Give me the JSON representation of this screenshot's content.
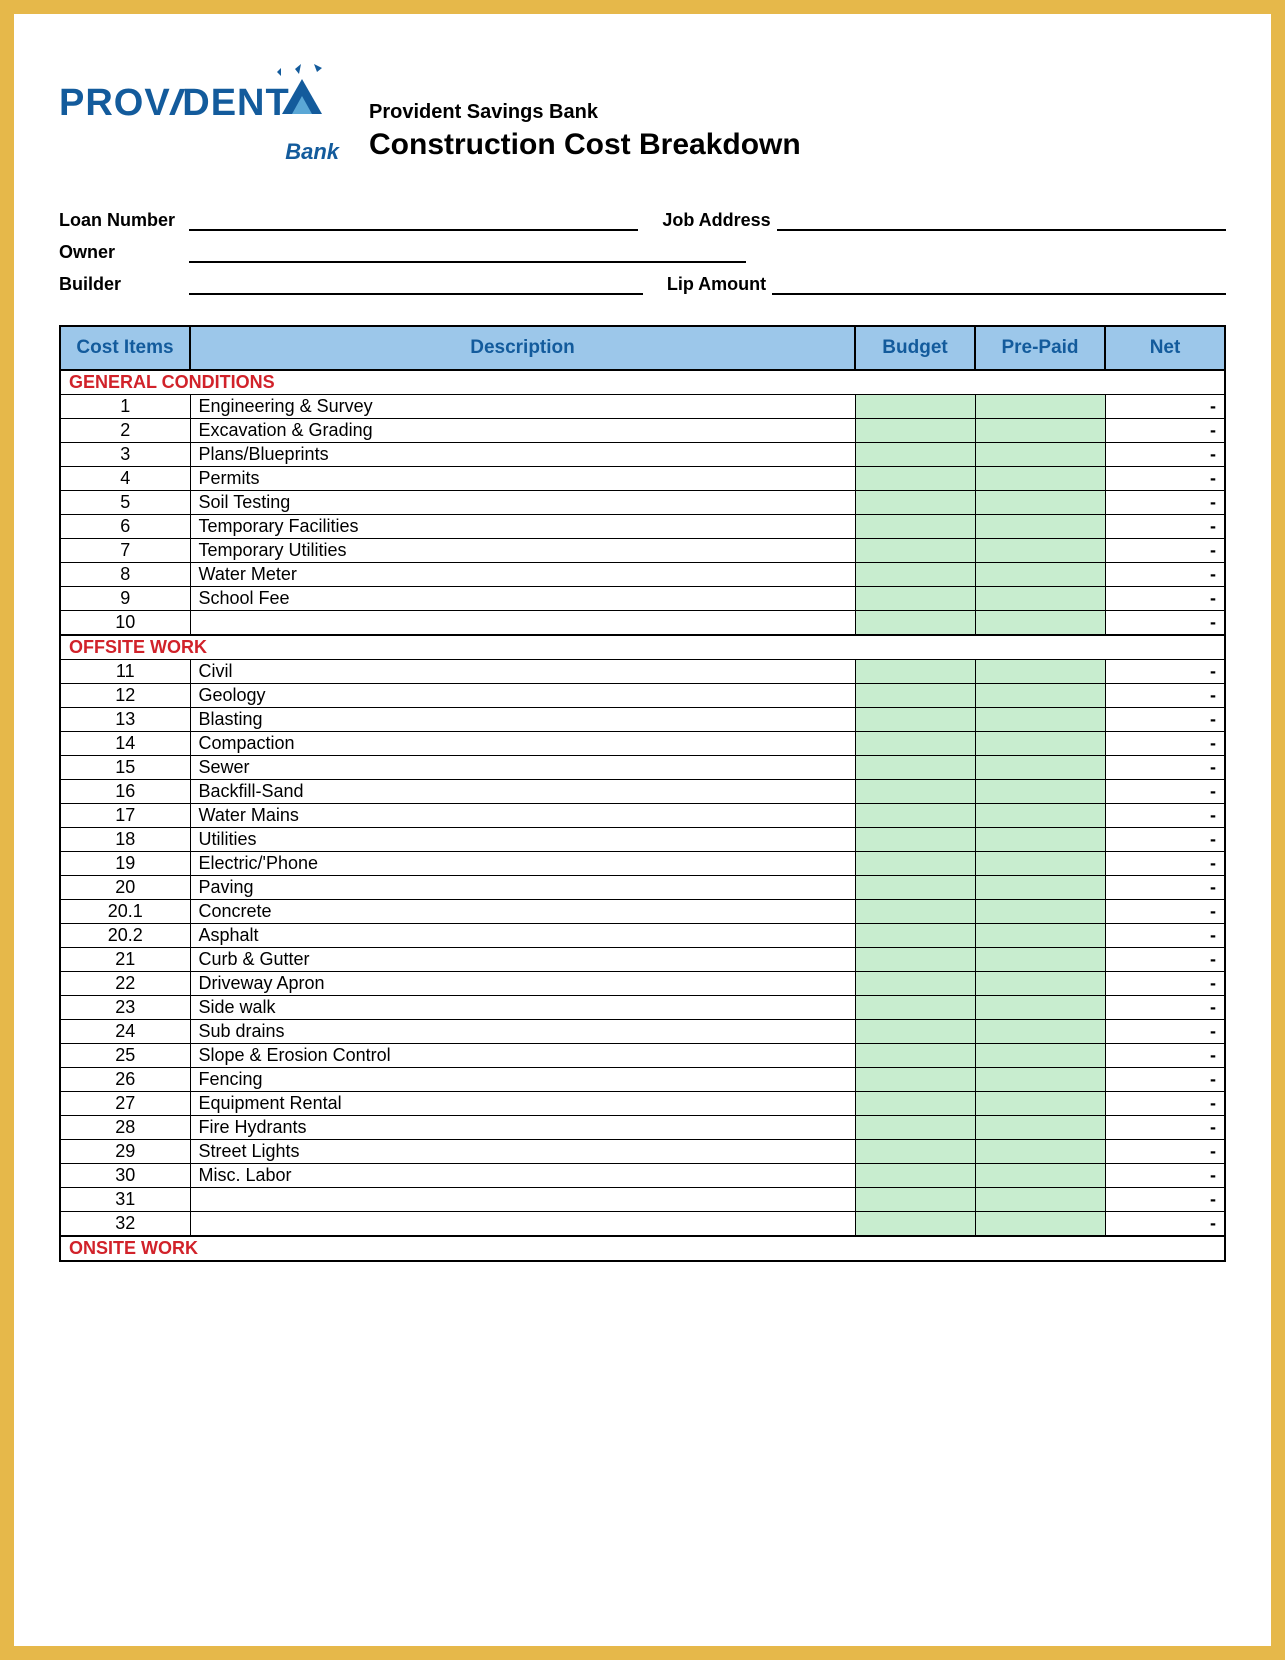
{
  "header": {
    "logo_text": "PROV",
    "logo_text2": "DENT",
    "logo_bank": "Bank",
    "subtitle": "Provident Savings Bank",
    "title": "Construction Cost Breakdown"
  },
  "form": {
    "loan_number_label": "Loan Number",
    "job_address_label": "Job Address",
    "owner_label": "Owner",
    "builder_label": "Builder",
    "lip_amount_label": "Lip Amount"
  },
  "columns": {
    "cost_items": "Cost  Items",
    "description": "Description",
    "budget": "Budget",
    "prepaid": "Pre-Paid",
    "net": "Net"
  },
  "sections": [
    {
      "title": "GENERAL CONDITIONS",
      "rows": [
        {
          "num": "1",
          "desc": "Engineering & Survey",
          "net": "-"
        },
        {
          "num": "2",
          "desc": "Excavation & Grading",
          "net": "-"
        },
        {
          "num": "3",
          "desc": "Plans/Blueprints",
          "net": "-"
        },
        {
          "num": "4",
          "desc": "Permits",
          "net": "-"
        },
        {
          "num": "5",
          "desc": "Soil Testing",
          "net": "-"
        },
        {
          "num": "6",
          "desc": "Temporary Facilities",
          "net": "-"
        },
        {
          "num": "7",
          "desc": "Temporary Utilities",
          "net": "-"
        },
        {
          "num": "8",
          "desc": "Water Meter",
          "net": "-"
        },
        {
          "num": "9",
          "desc": "School Fee",
          "net": "-"
        },
        {
          "num": "10",
          "desc": "",
          "net": "-"
        }
      ]
    },
    {
      "title": "OFFSITE WORK",
      "rows": [
        {
          "num": "11",
          "desc": "Civil",
          "net": "-"
        },
        {
          "num": "12",
          "desc": "Geology",
          "net": "-"
        },
        {
          "num": "13",
          "desc": "Blasting",
          "net": "-"
        },
        {
          "num": "14",
          "desc": "Compaction",
          "net": "-"
        },
        {
          "num": "15",
          "desc": "Sewer",
          "net": "-"
        },
        {
          "num": "16",
          "desc": "Backfill-Sand",
          "net": "-"
        },
        {
          "num": "17",
          "desc": "Water Mains",
          "net": "-"
        },
        {
          "num": "18",
          "desc": "Utilities",
          "net": "-"
        },
        {
          "num": "19",
          "desc": "Electric/'Phone",
          "net": "-"
        },
        {
          "num": "20",
          "desc": "Paving",
          "net": "-"
        },
        {
          "num": "20.1",
          "desc": "Concrete",
          "net": "-"
        },
        {
          "num": "20.2",
          "desc": "Asphalt",
          "net": "-"
        },
        {
          "num": "21",
          "desc": "Curb & Gutter",
          "net": "-"
        },
        {
          "num": "22",
          "desc": "Driveway Apron",
          "net": "-"
        },
        {
          "num": "23",
          "desc": "Side walk",
          "net": "-"
        },
        {
          "num": "24",
          "desc": "Sub drains",
          "net": "-"
        },
        {
          "num": "25",
          "desc": "Slope & Erosion Control",
          "net": "-"
        },
        {
          "num": "26",
          "desc": "Fencing",
          "net": "-"
        },
        {
          "num": "27",
          "desc": "Equipment Rental",
          "net": "-"
        },
        {
          "num": "28",
          "desc": "Fire Hydrants",
          "net": "-"
        },
        {
          "num": "29",
          "desc": "Street Lights",
          "net": "-"
        },
        {
          "num": "30",
          "desc": "Misc. Labor",
          "net": "-"
        },
        {
          "num": "31",
          "desc": "",
          "net": "-"
        },
        {
          "num": "32",
          "desc": "",
          "net": "-"
        }
      ]
    },
    {
      "title": "ONSITE WORK",
      "rows": []
    }
  ]
}
